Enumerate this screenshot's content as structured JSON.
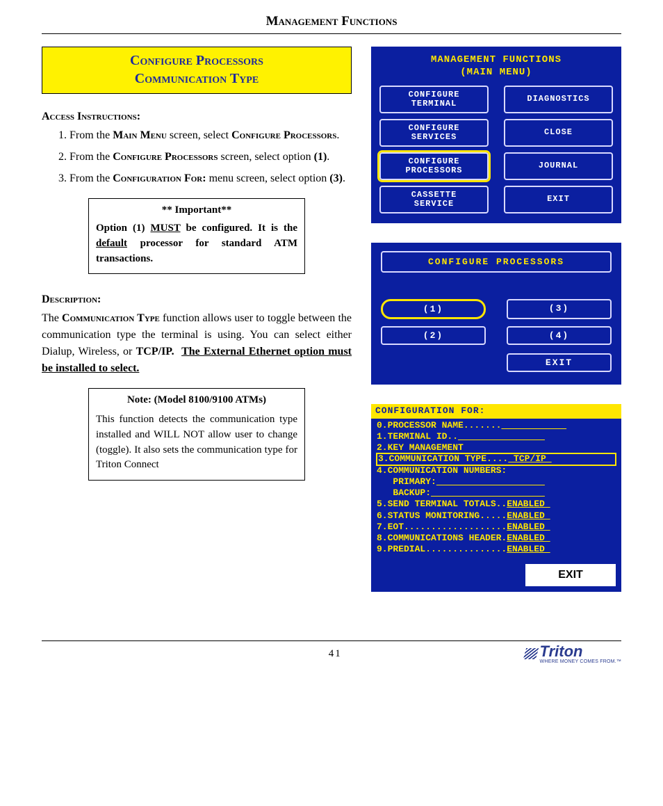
{
  "header": "Management Functions",
  "title": {
    "line1": "Configure  Processors",
    "line2": "Communication Type"
  },
  "access": {
    "heading": "Access Instructions:",
    "steps": [
      {
        "pre": "From the ",
        "mid": "Main Menu",
        "post": " screen, select ",
        "tail": "Configure Processors",
        "end": "."
      },
      {
        "pre": "From the ",
        "mid": "Configure Processors",
        "post": " screen, select option ",
        "bold": "(1)",
        "end": "."
      },
      {
        "pre": "From the ",
        "mid": "Configuration For:",
        "post": " menu screen, select option  ",
        "bold": "(3)",
        "end": "."
      }
    ]
  },
  "important": {
    "title": "** Important**",
    "body_pre": "Option (1) ",
    "body_must": "MUST",
    "body_mid": " be configured. It is the ",
    "body_def": "default",
    "body_post": " processor for standard ATM transactions."
  },
  "description": {
    "heading": "Description:",
    "para_pre": "The ",
    "para_ct": "Communication Type",
    "para_mid": " function allows user to toggle between the communication type the terminal is using. You can select either Dialup, Wireless, or ",
    "para_tcp": "TCP/IP.",
    "para_ext": "The External Ethernet option must be installed to select."
  },
  "note": {
    "title": "Note: (Model 8100/9100 ATMs)",
    "body": "This function detects the communication type installed and WILL NOT allow user to change (toggle). It also sets the communication type for Triton Connect"
  },
  "mainmenu": {
    "title_l1": "MANAGEMENT FUNCTIONS",
    "title_l2": "(MAIN MENU)",
    "buttons": [
      {
        "label": "CONFIGURE\nTERMINAL"
      },
      {
        "label": "DIAGNOSTICS"
      },
      {
        "label": "CONFIGURE\nSERVICES"
      },
      {
        "label": "CLOSE"
      },
      {
        "label": "CONFIGURE\nPROCESSORS",
        "selected": true
      },
      {
        "label": "JOURNAL"
      },
      {
        "label": "CASSETTE\nSERVICE"
      },
      {
        "label": "EXIT"
      }
    ]
  },
  "cfgproc": {
    "title": "CONFIGURE PROCESSORS",
    "buttons": [
      {
        "label": "(1)",
        "selected": true
      },
      {
        "label": "(3)"
      },
      {
        "label": "(2)"
      },
      {
        "label": "(4)"
      }
    ],
    "exit": "EXIT"
  },
  "cfgfor": {
    "head": "CONFIGURATION FOR:",
    "lines": [
      {
        "label": "0.PROCESSOR NAME.......",
        "value": "____________"
      },
      {
        "label": "1.TERMINAL ID..",
        "value": "________________"
      },
      {
        "label": "2.KEY MANAGEMENT",
        "value": ""
      },
      {
        "label": "3.COMMUNICATION TYPE....",
        "value": " TCP/IP ",
        "hl": true
      },
      {
        "label": "4.COMMUNICATION NUMBERS:",
        "value": ""
      },
      {
        "label": "   PRIMARY:",
        "value": " ___________________"
      },
      {
        "label": "   BACKUP:",
        "value": "  ___________________"
      },
      {
        "label": "5.SEND TERMINAL TOTALS..",
        "value": "ENABLED "
      },
      {
        "label": "6.STATUS MONITORING.....",
        "value": "ENABLED "
      },
      {
        "label": "7.EOT...................",
        "value": "ENABLED "
      },
      {
        "label": "8.COMMUNICATIONS HEADER.",
        "value": "ENABLED "
      },
      {
        "label": "9.PREDIAL...............",
        "value": "ENABLED "
      }
    ],
    "exit": "EXIT"
  },
  "footer": {
    "page": "41",
    "logo_name": "Triton",
    "logo_tag": "WHERE MONEY COMES FROM.™"
  }
}
